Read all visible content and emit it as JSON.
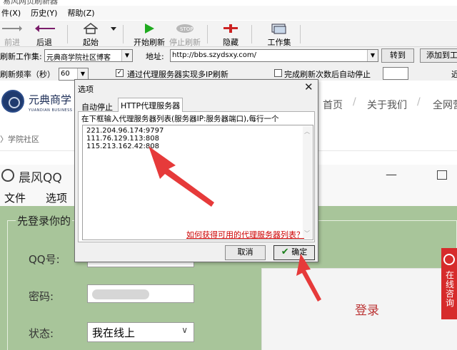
{
  "window": {
    "title": "易风网页刷新器"
  },
  "menu": [
    {
      "label": "件(X)"
    },
    {
      "label": "历史(Y)"
    },
    {
      "label": "帮助(Z)"
    }
  ],
  "toolbar": {
    "forward": "前进",
    "back": "后退",
    "home": "起始",
    "start_refresh": "开始刷新",
    "stop_refresh": "停止刷新",
    "hide": "隐藏",
    "workset": "工作集"
  },
  "address_row": {
    "workset_label": "刷新工作集:",
    "workset_value": "元典商学院社区博客",
    "address_label": "地址:",
    "address_value": "http://bbs.szydsxy.com/",
    "goto_button": "转到",
    "add_button": "添加到工"
  },
  "freq_row": {
    "freq_label": "刷新频率（秒）",
    "freq_value": "60",
    "proxy_label": "通过代理服务器实现多IP刷新",
    "proxy_checked": true,
    "auto_stop_label": "完成刷新次数后自动停止",
    "auto_stop_checked": false,
    "trailing": "近"
  },
  "site": {
    "brand": "元典商学",
    "brand_en": "YUANDIAN BUSINESS SC",
    "nav": [
      "首页",
      "关于我们",
      "全网营"
    ],
    "breadcrumb": "〉学院社区"
  },
  "qq_window": {
    "title": "晨风QQ",
    "menu": [
      "文件",
      "选项"
    ],
    "section_title": "先登录你的",
    "qq_label": "QQ号:",
    "password_label": "密码:",
    "status_label": "状态:",
    "status_value": "我在线上",
    "login_button": "登录"
  },
  "side_widget": {
    "text": "在线咨询"
  },
  "dialog": {
    "title": "选项",
    "tabs": [
      "自动停止",
      "HTTP代理服务器"
    ],
    "active_tab": 1,
    "hint": "在下框输入代理服务器列表(服务器IP:服务器端口),每行一个",
    "proxies": [
      "221.204.96.174:9797",
      "111.76.129.113:808",
      "115.213.162.42:808"
    ],
    "help_link": "如何获得可用的代理服务器列表？",
    "cancel_button": "取消",
    "ok_button": "确定"
  },
  "colors": {
    "annotation_arrow": "#e63a3a",
    "qq_green": "#a8c59a",
    "link_red": "#cc0000"
  }
}
